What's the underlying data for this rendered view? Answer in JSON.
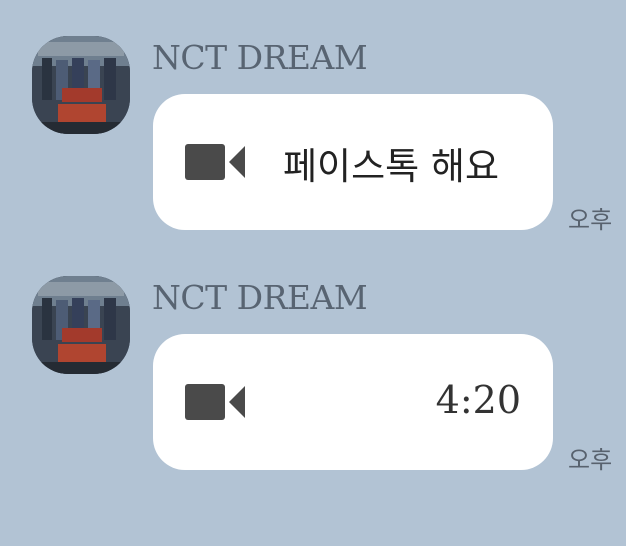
{
  "colors": {
    "background": "#b2c3d4",
    "bubble": "#ffffff",
    "icon": "#4a4a4a",
    "sender_text": "#586472",
    "time_text": "#58626e"
  },
  "messages": [
    {
      "sender": "NCT DREAM",
      "avatar_icon": "album-cover-avatar",
      "icon": "video-camera-icon",
      "text": "페이스톡 해요",
      "duration": "",
      "time": "오후"
    },
    {
      "sender": "NCT DREAM",
      "avatar_icon": "album-cover-avatar",
      "icon": "video-camera-icon",
      "text": "",
      "duration": "4:20",
      "time": "오후"
    }
  ]
}
